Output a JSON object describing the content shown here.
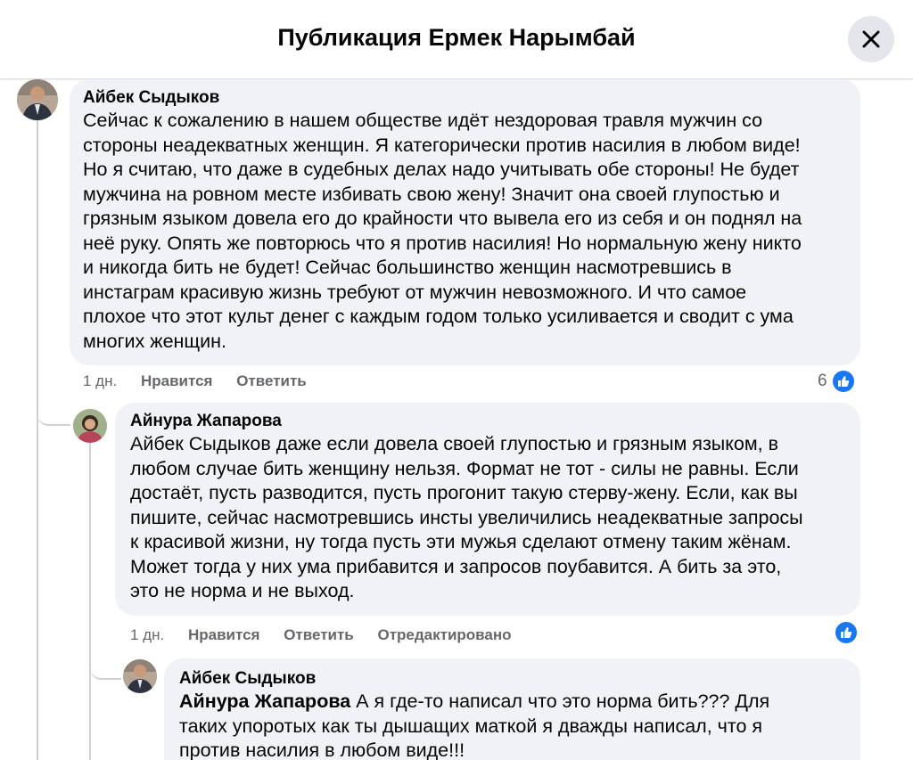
{
  "header": {
    "title": "Публикация Ермек Нарымбай"
  },
  "comments": [
    {
      "author": "Айбек Сыдыков",
      "lines": [
        "Сейчас к сожалению в нашем обществе идёт нездоровая травля мужчин со",
        "стороны неадекватных женщин. Я категорически против насилия в любом виде!",
        "Но я считаю, что даже в судебных делах надо учитывать обе стороны! Не будет",
        "мужчина на ровном месте избивать свою жену! Значит она своей глупостью и",
        "грязным языком довела его до крайности что вывела его из себя и он поднял на",
        "неё руку. Опять же повторюсь что я против насилия! Но нормальную жену никто",
        "и никогда бить не будет! Сейчас большинство женщин насмотревшись в",
        "инстаграм красивую жизнь требуют от мужчин невозможного. И что самое",
        "плохое что этот культ денег с каждым годом только усиливается и сводит с ума",
        "многих женщин."
      ],
      "time": "1 дн.",
      "like_label": "Нравится",
      "reply_label": "Ответить",
      "likes": "6"
    },
    {
      "author": "Айнура Жапарова",
      "lines": [
        "Айбек Сыдыков даже если довела своей глупостью и грязным языком, в",
        "любом случае бить женщину нельзя. Формат не тот - силы не равны. Если",
        "достаёт, пусть разводится, пусть прогонит такую стерву-жену. Если, как вы",
        "пишите, сейчас насмотревшись инсты увеличились неадекватные запросы",
        "к красивой жизни, ну тогда пусть эти мужья сделают отмену таким жёнам.",
        "Может тогда у них ума прибавится и запросов поубавится. А бить за это,",
        "это не норма и не выход."
      ],
      "time": "1 дн.",
      "like_label": "Нравится",
      "reply_label": "Ответить",
      "edited_label": "Отредактировано"
    },
    {
      "author": "Айбек Сыдыков",
      "mention": "Айнура Жапарова",
      "first_line_rest": " А я где-то написал что это норма бить??? Для",
      "lines": [
        "таких упоротых как ты дышащих маткой я дважды написал, что я",
        "против насилия в любом виде!!!"
      ]
    }
  ],
  "colors": {
    "bubble": "#f0f2f5",
    "like_blue": "#1877f2",
    "meta": "#65676b"
  }
}
